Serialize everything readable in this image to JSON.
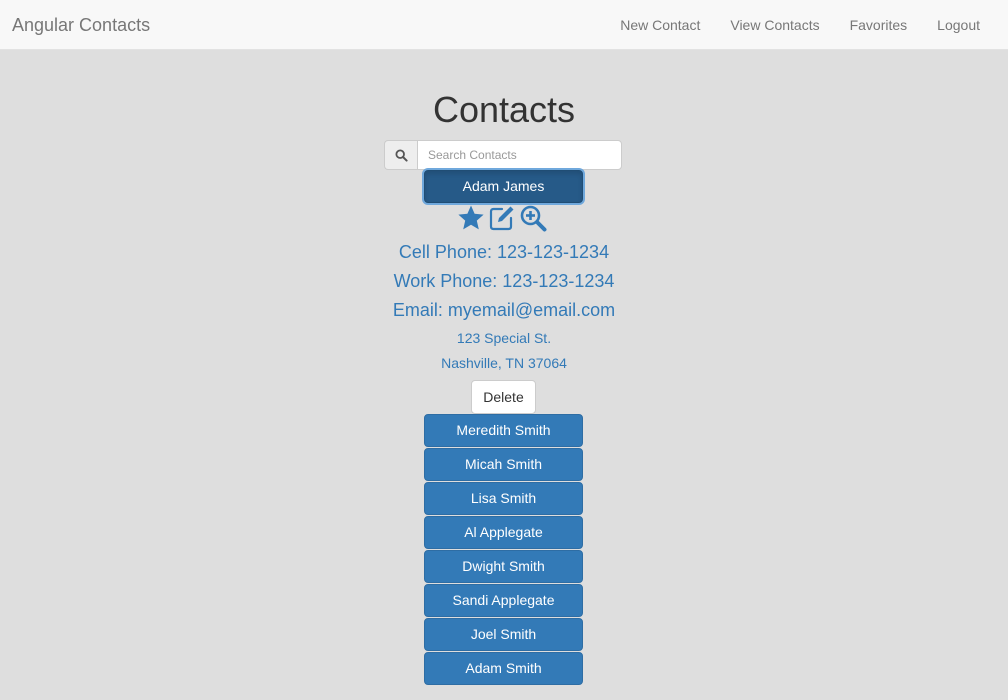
{
  "navbar": {
    "brand": "Angular Contacts",
    "links": [
      "New Contact",
      "View Contacts",
      "Favorites",
      "Logout"
    ]
  },
  "page": {
    "title": "Contacts"
  },
  "search": {
    "placeholder": "Search Contacts",
    "value": "",
    "icon": "search-icon"
  },
  "selected_contact": {
    "name": "Adam James",
    "actions": [
      "star-icon",
      "edit-icon",
      "zoom-in-icon"
    ],
    "cell_phone": "Cell Phone: 123-123-1234",
    "work_phone": "Work Phone: 123-123-1234",
    "email": "Email: myemail@email.com",
    "street": "123 Special St.",
    "city_line": "Nashville, TN 37064",
    "delete_label": "Delete"
  },
  "contacts": [
    "Meredith Smith",
    "Micah Smith",
    "Lisa Smith",
    "Al Applegate",
    "Dwight Smith",
    "Sandi Applegate",
    "Joel Smith",
    "Adam Smith"
  ],
  "colors": {
    "primary": "#337ab7",
    "primary_active": "#265a88",
    "background": "#dedede",
    "navbar": "#f8f8f8"
  }
}
